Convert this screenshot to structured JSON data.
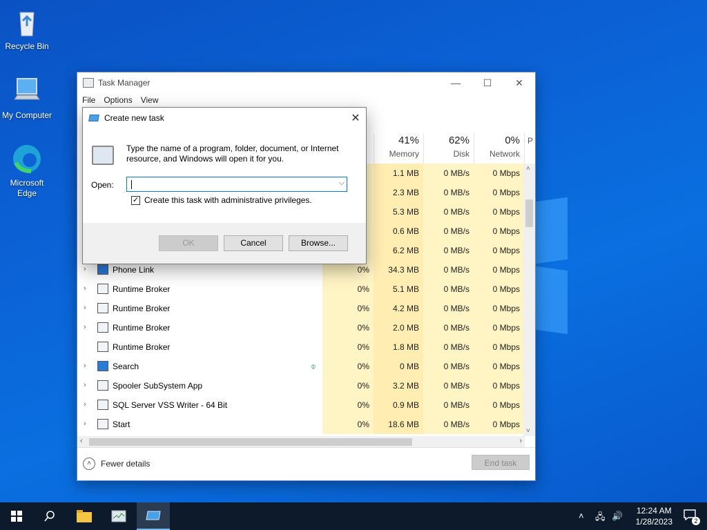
{
  "desktop": {
    "icons": [
      {
        "label": "Recycle Bin"
      },
      {
        "label": "My Computer"
      },
      {
        "label": "Microsoft Edge"
      }
    ]
  },
  "task_manager": {
    "title": "Task Manager",
    "menu": [
      "File",
      "Options",
      "View"
    ],
    "columns": [
      {
        "pct": "41%",
        "label": "Memory"
      },
      {
        "pct": "62%",
        "label": "Disk"
      },
      {
        "pct": "0%",
        "label": "Network"
      },
      {
        "pct": "",
        "label": "P"
      }
    ],
    "rows": [
      {
        "name": "",
        "cpu": "",
        "mem": "1.1 MB",
        "disk": "0 MB/s",
        "net": "0 Mbps",
        "chev": ""
      },
      {
        "name": "",
        "cpu": "",
        "mem": "2.3 MB",
        "disk": "0 MB/s",
        "net": "0 Mbps",
        "chev": ""
      },
      {
        "name": "",
        "cpu": "",
        "mem": "5.3 MB",
        "disk": "0 MB/s",
        "net": "0 Mbps",
        "chev": ""
      },
      {
        "name": "",
        "cpu": "",
        "mem": "0.6 MB",
        "disk": "0 MB/s",
        "net": "0 Mbps",
        "chev": ""
      },
      {
        "name": "",
        "cpu": "",
        "mem": "6.2 MB",
        "disk": "0 MB/s",
        "net": "0 Mbps",
        "chev": ""
      },
      {
        "name": "Phone Link",
        "cpu": "0%",
        "mem": "34.3 MB",
        "disk": "0 MB/s",
        "net": "0 Mbps",
        "chev": "›"
      },
      {
        "name": "Runtime Broker",
        "cpu": "0%",
        "mem": "5.1 MB",
        "disk": "0 MB/s",
        "net": "0 Mbps",
        "chev": "›"
      },
      {
        "name": "Runtime Broker",
        "cpu": "0%",
        "mem": "4.2 MB",
        "disk": "0 MB/s",
        "net": "0 Mbps",
        "chev": "›"
      },
      {
        "name": "Runtime Broker",
        "cpu": "0%",
        "mem": "2.0 MB",
        "disk": "0 MB/s",
        "net": "0 Mbps",
        "chev": "›"
      },
      {
        "name": "Runtime Broker",
        "cpu": "0%",
        "mem": "1.8 MB",
        "disk": "0 MB/s",
        "net": "0 Mbps",
        "chev": ""
      },
      {
        "name": "Search",
        "cpu": "0%",
        "mem": "0 MB",
        "disk": "0 MB/s",
        "net": "0 Mbps",
        "chev": "›"
      },
      {
        "name": "Spooler SubSystem App",
        "cpu": "0%",
        "mem": "3.2 MB",
        "disk": "0 MB/s",
        "net": "0 Mbps",
        "chev": "›"
      },
      {
        "name": "SQL Server VSS Writer - 64 Bit",
        "cpu": "0%",
        "mem": "0.9 MB",
        "disk": "0 MB/s",
        "net": "0 Mbps",
        "chev": "›"
      },
      {
        "name": "Start",
        "cpu": "0%",
        "mem": "18.6 MB",
        "disk": "0 MB/s",
        "net": "0 Mbps",
        "chev": "›"
      }
    ],
    "fewer_details": "Fewer details",
    "end_task": "End task"
  },
  "dialog": {
    "title": "Create new task",
    "description": "Type the name of a program, folder, document, or Internet resource, and Windows will open it for you.",
    "open_label": "Open:",
    "open_value": "",
    "checkbox_label": "Create this task with administrative privileges.",
    "checkbox_checked": true,
    "ok": "OK",
    "cancel": "Cancel",
    "browse": "Browse..."
  },
  "taskbar": {
    "time": "12:24 AM",
    "date": "1/28/2023",
    "notification_count": "2"
  }
}
